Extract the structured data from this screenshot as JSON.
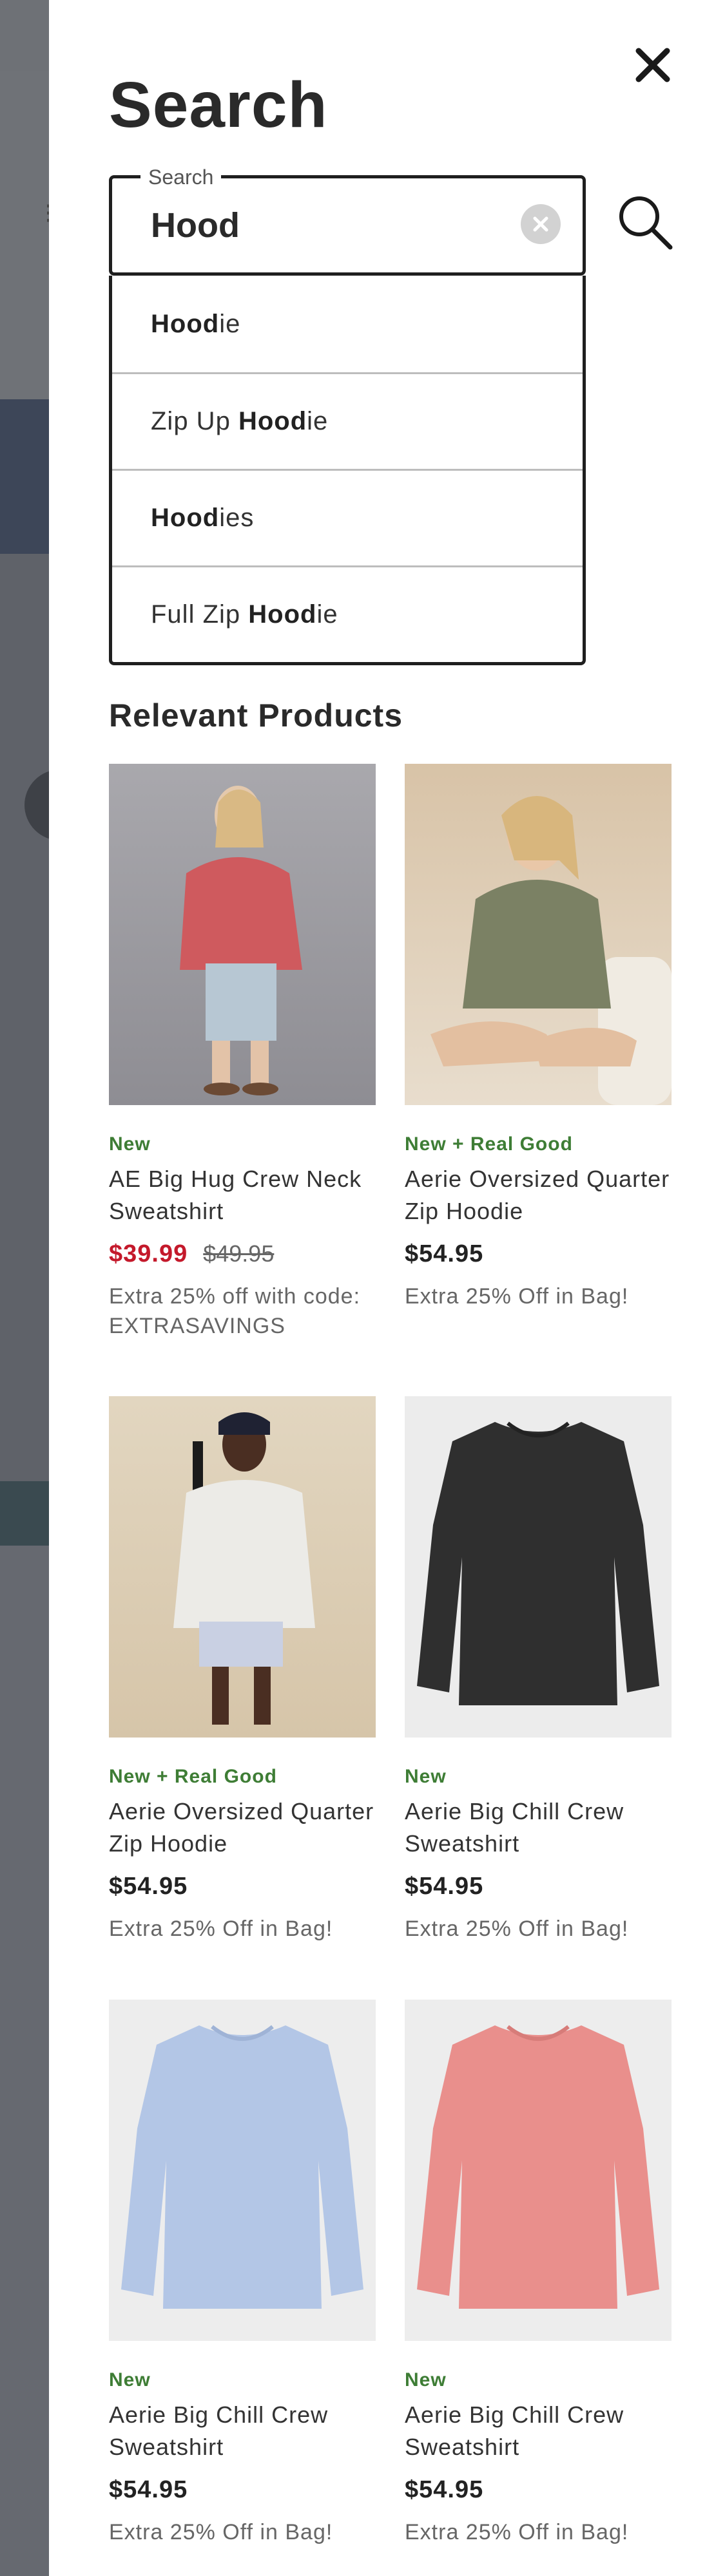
{
  "header": {
    "title": "Search",
    "close_icon": "close-icon"
  },
  "search": {
    "legend": "Search",
    "value": "Hood",
    "clear_icon": "clear-icon",
    "submit_icon": "search-icon"
  },
  "suggestions": [
    {
      "match": "Hood",
      "before": "",
      "after": "ie"
    },
    {
      "match": "Hood",
      "before": "Zip Up ",
      "after": "ie"
    },
    {
      "match": "Hood",
      "before": "",
      "after": "ies"
    },
    {
      "match": "Hood",
      "before": "Full Zip ",
      "after": "ie"
    }
  ],
  "relevant_title": "Relevant Products",
  "products": [
    {
      "badge": "New",
      "name": "AE Big Hug Crew Neck Sweatshirt",
      "price": "$39.99",
      "original_price": "$49.95",
      "promo": "Extra 25% off with code: EXTRASAVINGS",
      "image": "pink-sweatshirt-model-photo"
    },
    {
      "badge": "New + Real Good",
      "name": "Aerie Oversized Quarter Zip Hoodie",
      "price": "$54.95",
      "original_price": "",
      "promo": "Extra 25% Off in Bag!",
      "image": "olive-hoodie-model-photo"
    },
    {
      "badge": "New + Real Good",
      "name": "Aerie Oversized Quarter Zip Hoodie",
      "price": "$54.95",
      "original_price": "",
      "promo": "Extra 25% Off in Bag!",
      "image": "white-hoodie-model-photo"
    },
    {
      "badge": "New",
      "name": "Aerie Big Chill Crew Sweatshirt",
      "price": "$54.95",
      "original_price": "",
      "promo": "Extra 25% Off in Bag!",
      "image": "black-sweatshirt-photo"
    },
    {
      "badge": "New",
      "name": "Aerie Big Chill Crew Sweatshirt",
      "price": "$54.95",
      "original_price": "",
      "promo": "Extra 25% Off in Bag!",
      "image": "light-blue-sweatshirt-photo"
    },
    {
      "badge": "New",
      "name": "Aerie Big Chill Crew Sweatshirt",
      "price": "$54.95",
      "original_price": "",
      "promo": "Extra 25% Off in Bag!",
      "image": "coral-sweatshirt-photo"
    }
  ],
  "colors": {
    "badge_green": "#3e7d35",
    "sale_red": "#c4192b",
    "overlay": "#5c5f66"
  }
}
